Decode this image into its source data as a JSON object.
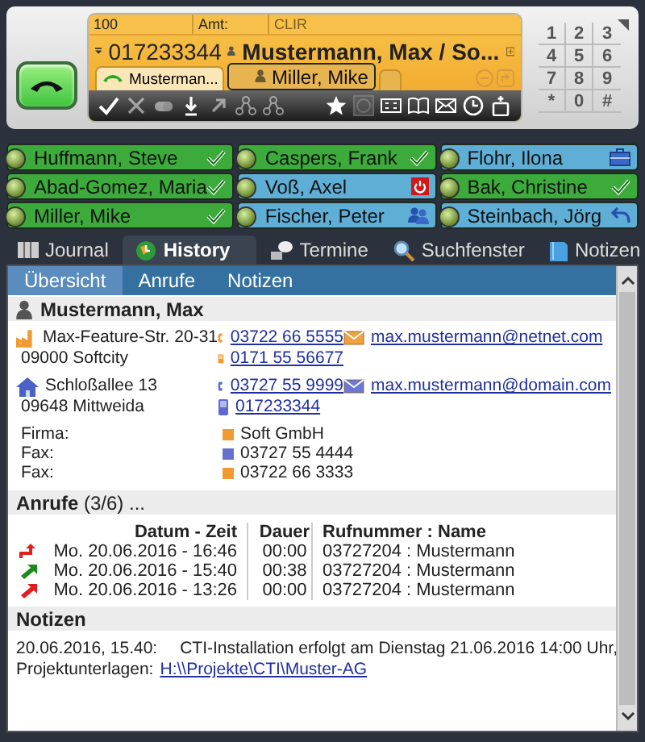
{
  "line": {
    "extension": "100",
    "trunk_label": "Amt:",
    "clir": {
      "label": "CLIR",
      "disabled": true
    },
    "number": "017233344",
    "caller": "Mustermann, Max  /  So...",
    "call_tabs": [
      {
        "label": "Musterman...",
        "kind": "active-call",
        "selected": true
      },
      {
        "label": "Miller, Mike",
        "kind": "contact",
        "selected": false
      },
      {
        "kind": "empty",
        "selected": false
      }
    ]
  },
  "keypad": [
    "1",
    "2",
    "3",
    "4",
    "5",
    "6",
    "7",
    "8",
    "9",
    "*",
    "0",
    "#"
  ],
  "contacts": [
    {
      "name": "Huffmann, Steve",
      "color": "#3cab3c",
      "kind": "check"
    },
    {
      "name": "Caspers, Frank",
      "color": "#3cab3c",
      "kind": "check"
    },
    {
      "name": "Flohr, Ilona",
      "color": "#5faed6",
      "kind": "briefcase"
    },
    {
      "name": "Abad-Gomez, Maria",
      "color": "#3cab3c",
      "kind": "check"
    },
    {
      "name": "Voß, Axel",
      "color": "#5faed6",
      "kind": "power"
    },
    {
      "name": "Bak, Christine",
      "color": "#3cab3c",
      "kind": "check"
    },
    {
      "name": "Miller, Mike",
      "color": "#3cab3c",
      "kind": "check"
    },
    {
      "name": "Fischer, Peter",
      "color": "#5faed6",
      "kind": "people"
    },
    {
      "name": "Steinbach, Jörg",
      "color": "#5faed6",
      "kind": "reply"
    }
  ],
  "tabs": [
    {
      "label": "Journal",
      "kind": "journal",
      "selected": false
    },
    {
      "label": "History",
      "kind": "history",
      "selected": true
    },
    {
      "label": "Termine",
      "kind": "termine",
      "selected": false
    },
    {
      "label": "Suchfenster",
      "kind": "search",
      "selected": false
    },
    {
      "label": "Notizen",
      "kind": "notes",
      "selected": false
    }
  ],
  "subtabs": [
    {
      "label": "Übersicht",
      "selected": true
    },
    {
      "label": "Anrufe",
      "selected": false
    },
    {
      "label": "Notizen",
      "selected": false
    }
  ],
  "contact": {
    "name": "Mustermann, Max",
    "addresses": [
      {
        "kind": "work",
        "street": "Max-Feature-Str. 20-31",
        "city": "09000 Softcity",
        "phone": "03722 66 5555",
        "mobile": "0171 55 56677",
        "email": "max.mustermann@netnet.com"
      },
      {
        "kind": "home",
        "street": "Schloßallee 13",
        "city": "09648 Mittweida",
        "phone": "03727 55 9999",
        "mobile": "017233344",
        "email": "max.mustermann@domain.com"
      }
    ],
    "fields": [
      {
        "label": "Firma:",
        "value": "Soft GmbH",
        "color": "#f09a30"
      },
      {
        "label": "Fax:",
        "value": "03727 55 4444",
        "color": "#6670d0"
      },
      {
        "label": "Fax:",
        "value": "03722 66 3333",
        "color": "#f09a30"
      }
    ]
  },
  "calls": {
    "title": "**Anrufe** (3/6) ...",
    "columns": [
      "Datum - Zeit",
      "Dauer",
      "Rufnummer : Name"
    ],
    "rows": [
      {
        "kind": "turn",
        "color": "#e02020",
        "date": "Mo. 20.06.2016 - 16:46",
        "duration": "00:00",
        "caller": "03727204 : Mustermann"
      },
      {
        "kind": "arrow",
        "color": "#1e8a1e",
        "date": "Mo. 20.06.2016 - 15:40",
        "duration": "00:38",
        "caller": "03727204 : Mustermann"
      },
      {
        "kind": "arrow",
        "color": "#e02020",
        "date": "Mo. 20.06.2016 - 13:26",
        "duration": "00:00",
        "caller": "03727204 : Mustermann"
      }
    ]
  },
  "notes": {
    "title": "Notizen",
    "items": [
      {
        "date": "20.06.2016, 15.40:",
        "text": "CTI-Installation erfolgt am Dienstag 21.06.2016 14:00 Uhr,",
        "label": "Projektunterlagen:",
        "link": "H:\\\\Projekte\\CTI\\Muster-AG"
      }
    ]
  }
}
